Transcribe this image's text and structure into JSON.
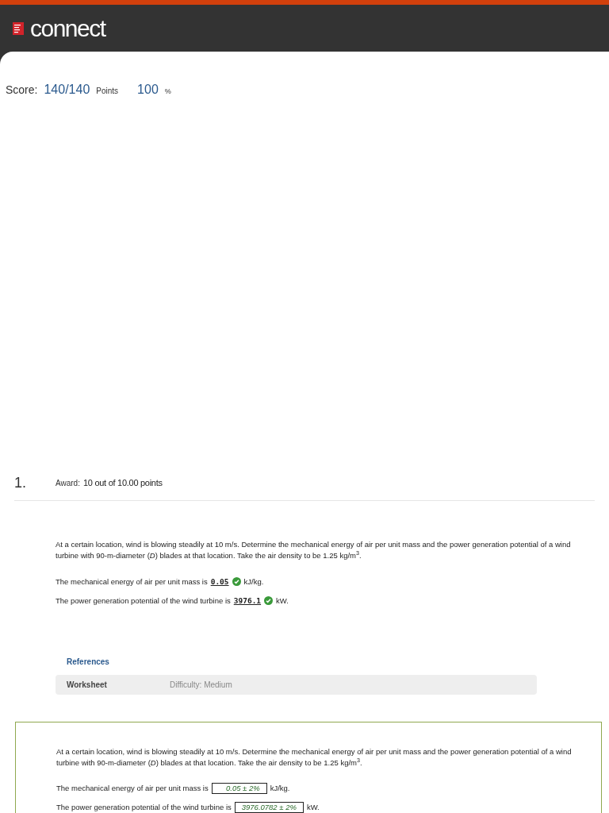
{
  "header": {
    "logo_text": "connect"
  },
  "score": {
    "label": "Score:",
    "value": "140/140",
    "points_label": "Points",
    "percent": "100",
    "percent_sign": "%"
  },
  "question": {
    "number": "1.",
    "award_label": "Award:",
    "award": "10 out of 10.00 points",
    "prompt": "At a certain location, wind is blowing steadily at 10 m/s. Determine the mechanical energy of air per unit mass and the power generation potential of a wind turbine with 90-m-diameter (*D*) blades at that location. Take the air density to be 1.25 kg/m$^{3}$.",
    "answers": [
      {
        "text": "The mechanical energy of air per unit mass is",
        "value": "0.05",
        "correct": true,
        "unit": "kJ/kg."
      },
      {
        "text": "The power generation potential of the wind turbine is",
        "value": "3976.1",
        "correct": true,
        "unit": "kW."
      }
    ]
  },
  "references": {
    "title": "References",
    "item": "Worksheet",
    "difficulty": "Difficulty: Medium"
  },
  "solution": {
    "prompt": "At a certain location, wind is blowing steadily at 10 m/s. Determine the mechanical energy of air per unit mass and the power generation potential of a wind turbine with 90-m-diameter (*D*) blades at that location. Take the air density to be 1.25 kg/m$^{3}$.",
    "answers": [
      {
        "text": "The mechanical energy of air per unit mass is",
        "value": "0.05 ± 2%",
        "unit": "kJ/kg."
      },
      {
        "text": "The power generation potential of the wind turbine is",
        "value": "3976.0782 ± 2%",
        "unit": "kW."
      }
    ]
  }
}
